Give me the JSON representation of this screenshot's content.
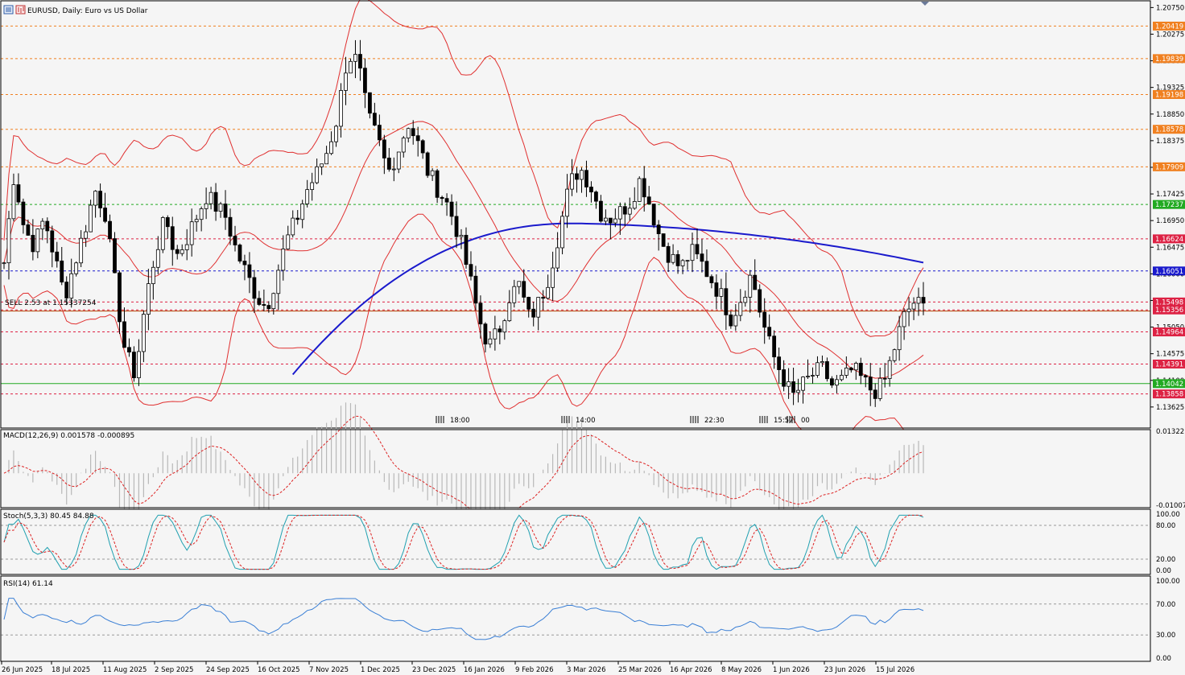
{
  "header": {
    "symbol_title": "EURUSD, Daily:  Euro vs US Dollar"
  },
  "icons": [
    "menu-icon",
    "chart-icon",
    "scroll-marker-icon"
  ],
  "colors": {
    "candle": "#000000",
    "bollinger": "#e03030",
    "ma200": "#1a1acc",
    "level_orange": "#f08020",
    "level_red": "#dd2244",
    "level_green": "#22aa22",
    "level_blue": "#1a1acc",
    "sell_line": "#b04000",
    "macd_hist": "#b8b8b8",
    "macd_signal": "#dd2222",
    "stoch_main": "#20a0b0",
    "stoch_signal": "#dd2222",
    "rsi": "#3a7fd5"
  },
  "trade_line": {
    "label": "SELL 2.53 at 1.15337254",
    "price": 1.15337
  },
  "chart_data": [
    {
      "type": "line",
      "title": "EURUSD, Daily:  Euro vs US Dollar",
      "ylim": [
        1.1325,
        1.2087
      ],
      "y_ticks": [
        "1.20750",
        "1.20275",
        "1.19800",
        "1.19325",
        "1.18850",
        "1.18375",
        "1.17900",
        "1.17425",
        "1.16950",
        "1.16475",
        "1.16000",
        "1.15525",
        "1.15050",
        "1.14575",
        "1.14100",
        "1.13625"
      ],
      "x_dates": [
        "26 Jun 2025",
        "18 Jul 2025",
        "11 Aug 2025",
        "2 Sep 2025",
        "24 Sep 2025",
        "16 Oct 2025",
        "7 Nov 2025",
        "1 Dec 2025",
        "23 Dec 2025",
        "16 Jan 2026",
        "9 Feb 2026",
        "3 Mar 2026",
        "25 Mar 2026",
        "16 Apr 2026",
        "8 May 2026",
        "1 Jun 2026",
        "23 Jun 2026",
        "15 Jul 2026"
      ],
      "price_levels": [
        {
          "label": "1.20419",
          "value": 1.20419,
          "style": "orange"
        },
        {
          "label": "1.19839",
          "value": 1.19839,
          "style": "orange"
        },
        {
          "label": "1.19198",
          "value": 1.19198,
          "style": "orange"
        },
        {
          "label": "1.18578",
          "value": 1.18578,
          "style": "orange"
        },
        {
          "label": "1.17909",
          "value": 1.17909,
          "style": "orange"
        },
        {
          "label": "1.17237",
          "value": 1.17237,
          "style": "green"
        },
        {
          "label": "1.16624",
          "value": 1.16624,
          "style": "red"
        },
        {
          "label": "1.16051",
          "value": 1.16051,
          "style": "blue"
        },
        {
          "label": "1.15498",
          "value": 1.15498,
          "style": "red"
        },
        {
          "label": "1.15356",
          "value": 1.15356,
          "style": "red"
        },
        {
          "label": "1.14964",
          "value": 1.14964,
          "style": "red"
        },
        {
          "label": "1.14391",
          "value": 1.14391,
          "style": "red"
        },
        {
          "label": "1.14042",
          "value": 1.14042,
          "style": "green"
        },
        {
          "label": "1.13858",
          "value": 1.13858,
          "style": "red"
        }
      ],
      "time_markers": [
        "18:00",
        "14:00",
        "22:30",
        "15:57",
        "00"
      ],
      "close_path": [
        [
          0,
          1.162
        ],
        [
          6,
          1.178
        ],
        [
          12,
          1.168
        ],
        [
          18,
          1.165
        ],
        [
          24,
          1.17
        ],
        [
          30,
          1.163
        ],
        [
          36,
          1.156
        ],
        [
          42,
          1.162
        ],
        [
          48,
          1.168
        ],
        [
          54,
          1.175
        ],
        [
          60,
          1.171
        ],
        [
          66,
          1.158
        ],
        [
          72,
          1.146
        ],
        [
          78,
          1.142
        ],
        [
          84,
          1.155
        ],
        [
          90,
          1.164
        ],
        [
          96,
          1.17
        ],
        [
          102,
          1.163
        ],
        [
          108,
          1.166
        ],
        [
          114,
          1.17
        ],
        [
          120,
          1.174
        ],
        [
          126,
          1.172
        ],
        [
          132,
          1.17
        ],
        [
          138,
          1.164
        ],
        [
          144,
          1.16
        ],
        [
          150,
          1.156
        ],
        [
          156,
          1.154
        ],
        [
          162,
          1.16
        ],
        [
          168,
          1.166
        ],
        [
          174,
          1.17
        ],
        [
          180,
          1.175
        ],
        [
          186,
          1.178
        ],
        [
          192,
          1.182
        ],
        [
          198,
          1.188
        ],
        [
          204,
          1.199
        ],
        [
          210,
          1.198
        ],
        [
          216,
          1.188
        ],
        [
          222,
          1.184
        ],
        [
          228,
          1.178
        ],
        [
          234,
          1.182
        ],
        [
          240,
          1.187
        ],
        [
          246,
          1.183
        ],
        [
          252,
          1.178
        ],
        [
          258,
          1.175
        ],
        [
          264,
          1.172
        ],
        [
          270,
          1.167
        ],
        [
          276,
          1.16
        ],
        [
          282,
          1.152
        ],
        [
          288,
          1.147
        ],
        [
          294,
          1.15
        ],
        [
          300,
          1.156
        ],
        [
          306,
          1.158
        ],
        [
          312,
          1.152
        ],
        [
          318,
          1.155
        ],
        [
          324,
          1.16
        ],
        [
          330,
          1.168
        ],
        [
          336,
          1.176
        ],
        [
          342,
          1.179
        ],
        [
          348,
          1.176
        ],
        [
          354,
          1.171
        ],
        [
          360,
          1.17
        ],
        [
          366,
          1.171
        ],
        [
          372,
          1.173
        ],
        [
          378,
          1.177
        ],
        [
          384,
          1.172
        ],
        [
          390,
          1.166
        ],
        [
          396,
          1.163
        ],
        [
          402,
          1.161
        ],
        [
          408,
          1.164
        ],
        [
          414,
          1.162
        ],
        [
          420,
          1.159
        ],
        [
          426,
          1.156
        ],
        [
          432,
          1.152
        ],
        [
          438,
          1.156
        ],
        [
          444,
          1.16
        ],
        [
          450,
          1.152
        ],
        [
          456,
          1.146
        ],
        [
          462,
          1.142
        ],
        [
          468,
          1.138
        ],
        [
          474,
          1.14
        ],
        [
          480,
          1.142
        ],
        [
          486,
          1.143
        ],
        [
          492,
          1.14
        ],
        [
          498,
          1.141
        ],
        [
          504,
          1.143
        ],
        [
          510,
          1.141
        ],
        [
          516,
          1.139
        ],
        [
          522,
          1.14
        ],
        [
          528,
          1.146
        ],
        [
          534,
          1.152
        ],
        [
          540,
          1.155
        ],
        [
          546,
          1.154
        ]
      ]
    },
    {
      "type": "bar",
      "title": "MACD(12,26,9) 0.001578 -0.000895",
      "ylim": [
        -0.01007,
        0.01322
      ],
      "y_ticks": [
        "0.01322",
        "-0.01007"
      ]
    },
    {
      "type": "line",
      "title": "Stoch(5,3,3) 80.45 84.88",
      "ylim": [
        0,
        100
      ],
      "y_ticks": [
        "100.00",
        "80.00",
        "20.00",
        "0.00"
      ],
      "levels": [
        80,
        20
      ]
    },
    {
      "type": "line",
      "title": "RSI(14) 61.14",
      "ylim": [
        0,
        100
      ],
      "y_ticks": [
        "100.00",
        "70.00",
        "30.00",
        "0.00"
      ],
      "levels": [
        70,
        30
      ]
    }
  ]
}
